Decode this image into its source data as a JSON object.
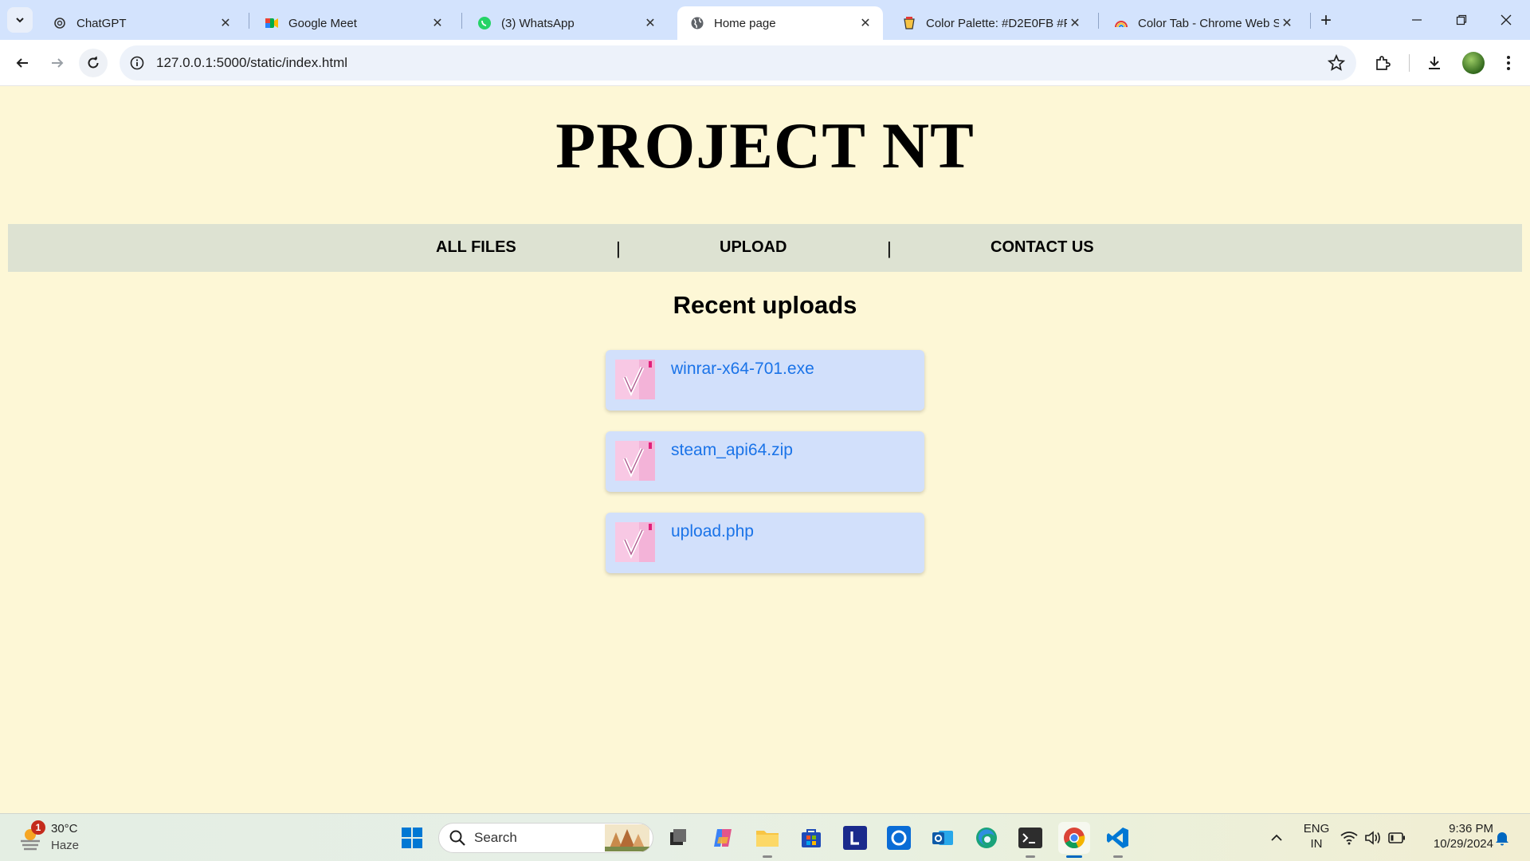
{
  "browser": {
    "tabs": [
      {
        "title": "ChatGPT",
        "icon": "chatgpt-icon"
      },
      {
        "title": "Google Meet",
        "icon": "google-meet-icon"
      },
      {
        "title": "(3) WhatsApp",
        "icon": "whatsapp-icon"
      },
      {
        "title": "Home page",
        "icon": "globe-icon",
        "active": true
      },
      {
        "title": "Color Palette: #D2E0FB #FE",
        "icon": "color-palette-icon"
      },
      {
        "title": "Color Tab - Chrome Web S",
        "icon": "rainbow-icon"
      }
    ],
    "url": "127.0.0.1:5000/static/index.html"
  },
  "site": {
    "title": "PROJECT NT",
    "nav": [
      {
        "label": "ALL FILES"
      },
      {
        "label": "UPLOAD"
      },
      {
        "label": "CONTACT US"
      }
    ],
    "nav_separator": "|",
    "section_title": "Recent uploads",
    "files": [
      {
        "name": "winrar-x64-701.exe"
      },
      {
        "name": "steam_api64.zip"
      },
      {
        "name": "upload.php"
      }
    ]
  },
  "taskbar": {
    "weather": {
      "temp": "30°C",
      "desc": "Haze",
      "badge": "1"
    },
    "search_placeholder": "Search",
    "language": {
      "line1": "ENG",
      "line2": "IN"
    },
    "clock": {
      "time": "9:36 PM",
      "date": "10/29/2024"
    }
  },
  "colors": {
    "page_background": "#FDF7D6",
    "navbar": "#DDE2D2",
    "file_card": "#D2E0FB",
    "file_link": "#1A73E8",
    "tabstrip": "#D3E3FD"
  }
}
